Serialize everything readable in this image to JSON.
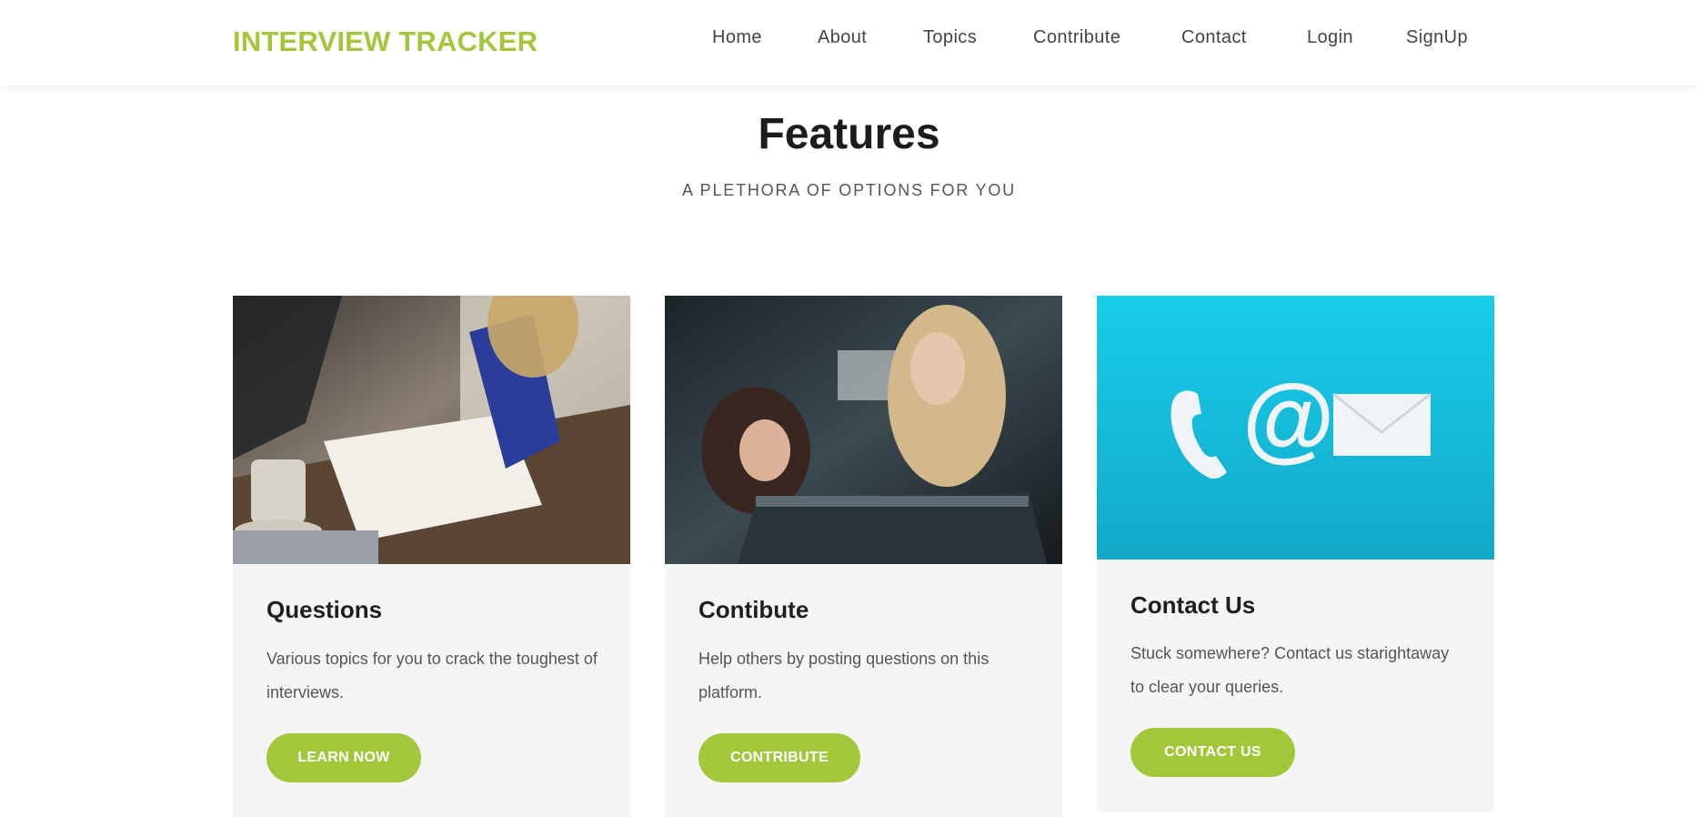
{
  "header": {
    "brand": "INTERVIEW TRACKER",
    "nav": [
      "Home",
      "About",
      "Topics",
      "Contribute",
      "Contact",
      "Login",
      "SignUp"
    ]
  },
  "features": {
    "title": "Features",
    "subtitle": "A PLETHORA OF OPTIONS FOR YOU"
  },
  "cards": [
    {
      "title": "Questions",
      "text": "Various topics for you to crack the toughest of interviews.",
      "button": "LEARN NOW",
      "image": "photo-study-notebook"
    },
    {
      "title": "Contibute",
      "text": "Help others by posting questions on this platform.",
      "button": "CONTRIBUTE",
      "image": "photo-women-at-computer"
    },
    {
      "title": "Contact Us",
      "text": "Stuck somewhere? Contact us starightaway to clear your queries.",
      "button": "CONTACT US",
      "image": "contact-icons-phone-at-envelope"
    }
  ],
  "colors": {
    "accent": "#a2c73b",
    "card_bg": "#f5f5f5",
    "contact_image_bg": "#17b3d6"
  }
}
